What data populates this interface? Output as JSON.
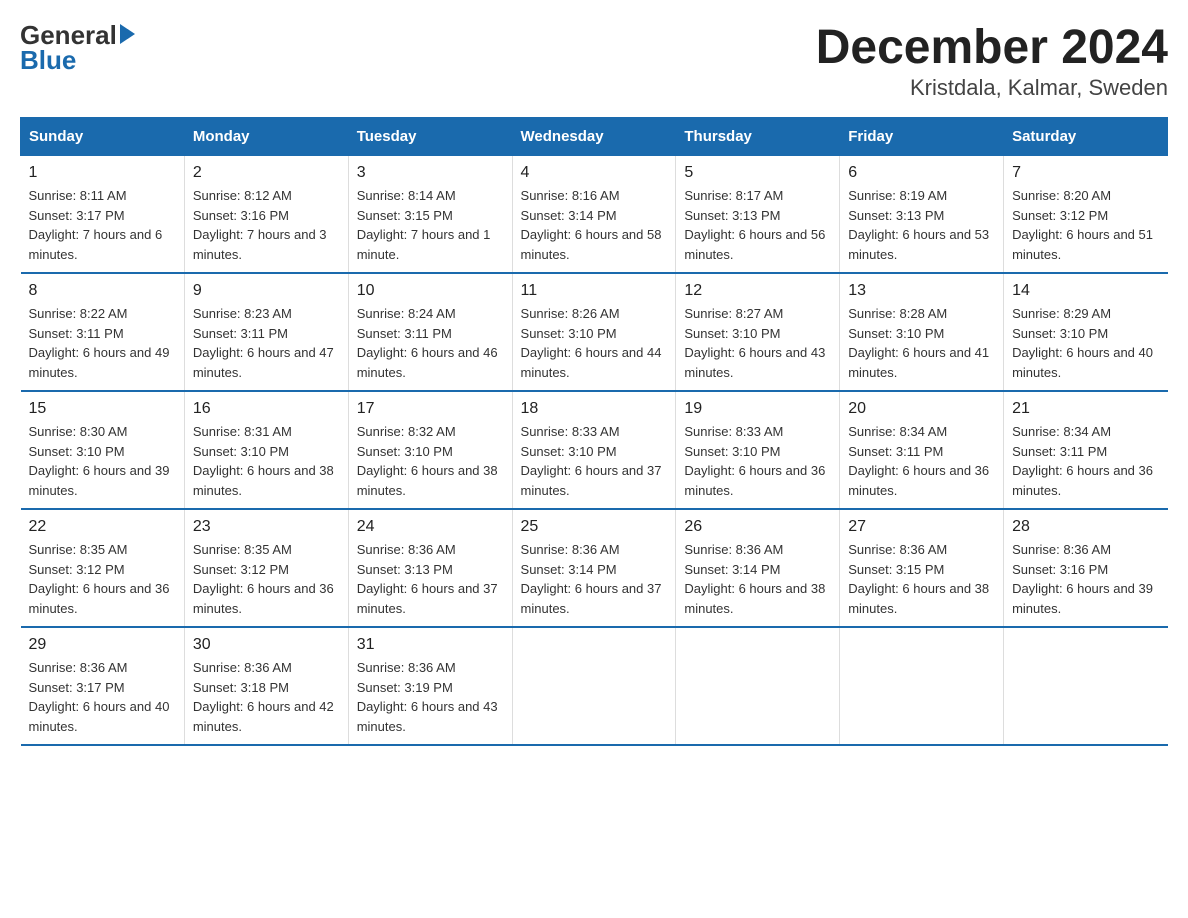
{
  "logo": {
    "general": "General",
    "blue": "Blue",
    "triangle": "▶"
  },
  "title": {
    "month_year": "December 2024",
    "location": "Kristdala, Kalmar, Sweden"
  },
  "headers": [
    "Sunday",
    "Monday",
    "Tuesday",
    "Wednesday",
    "Thursday",
    "Friday",
    "Saturday"
  ],
  "weeks": [
    [
      {
        "day": "1",
        "sunrise": "Sunrise: 8:11 AM",
        "sunset": "Sunset: 3:17 PM",
        "daylight": "Daylight: 7 hours and 6 minutes."
      },
      {
        "day": "2",
        "sunrise": "Sunrise: 8:12 AM",
        "sunset": "Sunset: 3:16 PM",
        "daylight": "Daylight: 7 hours and 3 minutes."
      },
      {
        "day": "3",
        "sunrise": "Sunrise: 8:14 AM",
        "sunset": "Sunset: 3:15 PM",
        "daylight": "Daylight: 7 hours and 1 minute."
      },
      {
        "day": "4",
        "sunrise": "Sunrise: 8:16 AM",
        "sunset": "Sunset: 3:14 PM",
        "daylight": "Daylight: 6 hours and 58 minutes."
      },
      {
        "day": "5",
        "sunrise": "Sunrise: 8:17 AM",
        "sunset": "Sunset: 3:13 PM",
        "daylight": "Daylight: 6 hours and 56 minutes."
      },
      {
        "day": "6",
        "sunrise": "Sunrise: 8:19 AM",
        "sunset": "Sunset: 3:13 PM",
        "daylight": "Daylight: 6 hours and 53 minutes."
      },
      {
        "day": "7",
        "sunrise": "Sunrise: 8:20 AM",
        "sunset": "Sunset: 3:12 PM",
        "daylight": "Daylight: 6 hours and 51 minutes."
      }
    ],
    [
      {
        "day": "8",
        "sunrise": "Sunrise: 8:22 AM",
        "sunset": "Sunset: 3:11 PM",
        "daylight": "Daylight: 6 hours and 49 minutes."
      },
      {
        "day": "9",
        "sunrise": "Sunrise: 8:23 AM",
        "sunset": "Sunset: 3:11 PM",
        "daylight": "Daylight: 6 hours and 47 minutes."
      },
      {
        "day": "10",
        "sunrise": "Sunrise: 8:24 AM",
        "sunset": "Sunset: 3:11 PM",
        "daylight": "Daylight: 6 hours and 46 minutes."
      },
      {
        "day": "11",
        "sunrise": "Sunrise: 8:26 AM",
        "sunset": "Sunset: 3:10 PM",
        "daylight": "Daylight: 6 hours and 44 minutes."
      },
      {
        "day": "12",
        "sunrise": "Sunrise: 8:27 AM",
        "sunset": "Sunset: 3:10 PM",
        "daylight": "Daylight: 6 hours and 43 minutes."
      },
      {
        "day": "13",
        "sunrise": "Sunrise: 8:28 AM",
        "sunset": "Sunset: 3:10 PM",
        "daylight": "Daylight: 6 hours and 41 minutes."
      },
      {
        "day": "14",
        "sunrise": "Sunrise: 8:29 AM",
        "sunset": "Sunset: 3:10 PM",
        "daylight": "Daylight: 6 hours and 40 minutes."
      }
    ],
    [
      {
        "day": "15",
        "sunrise": "Sunrise: 8:30 AM",
        "sunset": "Sunset: 3:10 PM",
        "daylight": "Daylight: 6 hours and 39 minutes."
      },
      {
        "day": "16",
        "sunrise": "Sunrise: 8:31 AM",
        "sunset": "Sunset: 3:10 PM",
        "daylight": "Daylight: 6 hours and 38 minutes."
      },
      {
        "day": "17",
        "sunrise": "Sunrise: 8:32 AM",
        "sunset": "Sunset: 3:10 PM",
        "daylight": "Daylight: 6 hours and 38 minutes."
      },
      {
        "day": "18",
        "sunrise": "Sunrise: 8:33 AM",
        "sunset": "Sunset: 3:10 PM",
        "daylight": "Daylight: 6 hours and 37 minutes."
      },
      {
        "day": "19",
        "sunrise": "Sunrise: 8:33 AM",
        "sunset": "Sunset: 3:10 PM",
        "daylight": "Daylight: 6 hours and 36 minutes."
      },
      {
        "day": "20",
        "sunrise": "Sunrise: 8:34 AM",
        "sunset": "Sunset: 3:11 PM",
        "daylight": "Daylight: 6 hours and 36 minutes."
      },
      {
        "day": "21",
        "sunrise": "Sunrise: 8:34 AM",
        "sunset": "Sunset: 3:11 PM",
        "daylight": "Daylight: 6 hours and 36 minutes."
      }
    ],
    [
      {
        "day": "22",
        "sunrise": "Sunrise: 8:35 AM",
        "sunset": "Sunset: 3:12 PM",
        "daylight": "Daylight: 6 hours and 36 minutes."
      },
      {
        "day": "23",
        "sunrise": "Sunrise: 8:35 AM",
        "sunset": "Sunset: 3:12 PM",
        "daylight": "Daylight: 6 hours and 36 minutes."
      },
      {
        "day": "24",
        "sunrise": "Sunrise: 8:36 AM",
        "sunset": "Sunset: 3:13 PM",
        "daylight": "Daylight: 6 hours and 37 minutes."
      },
      {
        "day": "25",
        "sunrise": "Sunrise: 8:36 AM",
        "sunset": "Sunset: 3:14 PM",
        "daylight": "Daylight: 6 hours and 37 minutes."
      },
      {
        "day": "26",
        "sunrise": "Sunrise: 8:36 AM",
        "sunset": "Sunset: 3:14 PM",
        "daylight": "Daylight: 6 hours and 38 minutes."
      },
      {
        "day": "27",
        "sunrise": "Sunrise: 8:36 AM",
        "sunset": "Sunset: 3:15 PM",
        "daylight": "Daylight: 6 hours and 38 minutes."
      },
      {
        "day": "28",
        "sunrise": "Sunrise: 8:36 AM",
        "sunset": "Sunset: 3:16 PM",
        "daylight": "Daylight: 6 hours and 39 minutes."
      }
    ],
    [
      {
        "day": "29",
        "sunrise": "Sunrise: 8:36 AM",
        "sunset": "Sunset: 3:17 PM",
        "daylight": "Daylight: 6 hours and 40 minutes."
      },
      {
        "day": "30",
        "sunrise": "Sunrise: 8:36 AM",
        "sunset": "Sunset: 3:18 PM",
        "daylight": "Daylight: 6 hours and 42 minutes."
      },
      {
        "day": "31",
        "sunrise": "Sunrise: 8:36 AM",
        "sunset": "Sunset: 3:19 PM",
        "daylight": "Daylight: 6 hours and 43 minutes."
      },
      null,
      null,
      null,
      null
    ]
  ]
}
